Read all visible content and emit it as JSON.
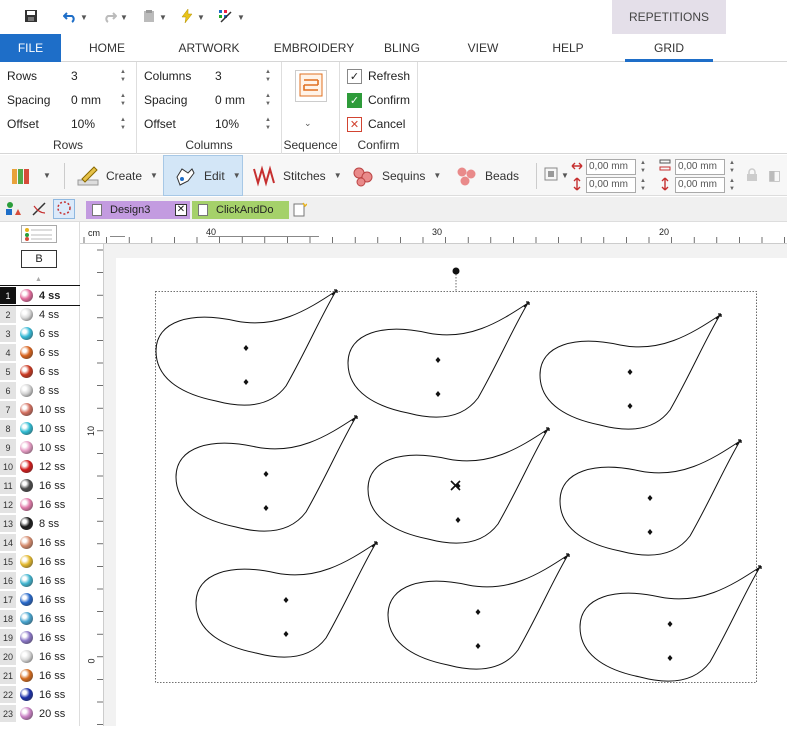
{
  "quick_access": {
    "icons": [
      "save-icon",
      "undo-icon",
      "redo-icon",
      "clipboard-icon",
      "lightning-icon",
      "grid-magic-icon"
    ]
  },
  "context_tab": "REPETITIONS",
  "tabs": [
    "FILE",
    "HOME",
    "ARTWORK",
    "EMBROIDERY",
    "BLING",
    "VIEW",
    "HELP",
    "GRID"
  ],
  "active_tab": "GRID",
  "ribbon": {
    "rows": {
      "label": "Rows",
      "fields": [
        {
          "name": "Rows",
          "value": "3"
        },
        {
          "name": "Spacing",
          "value": "0 mm"
        },
        {
          "name": "Offset",
          "value": "10%"
        }
      ]
    },
    "columns": {
      "label": "Columns",
      "fields": [
        {
          "name": "Columns",
          "value": "3"
        },
        {
          "name": "Spacing",
          "value": "0 mm"
        },
        {
          "name": "Offset",
          "value": "10%"
        }
      ]
    },
    "sequence": {
      "label": "Sequence"
    },
    "confirm": {
      "label": "Confirm",
      "refresh": "Refresh",
      "confirm": "Confirm",
      "cancel": "Cancel"
    }
  },
  "toolbar": {
    "create": "Create",
    "edit": "Edit",
    "stitches": "Stitches",
    "sequins": "Sequins",
    "beads": "Beads",
    "fields": [
      "0,00 mm",
      "0,00 mm",
      "0,00 mm",
      "0,00 mm"
    ]
  },
  "doc_tabs": [
    {
      "name": "Design3",
      "color": "#c39be0"
    },
    {
      "name": "ClickAndDo",
      "color": "#a5d16a"
    }
  ],
  "palette_header": "B",
  "palette": [
    {
      "n": "1",
      "size": "4 ss",
      "color": "#e26b9c"
    },
    {
      "n": "2",
      "size": "4 ss",
      "color": "#d9d9d9"
    },
    {
      "n": "3",
      "size": "6 ss",
      "color": "#35b9d6"
    },
    {
      "n": "4",
      "size": "6 ss",
      "color": "#d8621c"
    },
    {
      "n": "5",
      "size": "6 ss",
      "color": "#c9361f"
    },
    {
      "n": "6",
      "size": "8 ss",
      "color": "#d3d3d3"
    },
    {
      "n": "7",
      "size": "10 ss",
      "color": "#d36f5f"
    },
    {
      "n": "8",
      "size": "10 ss",
      "color": "#2fbcd3"
    },
    {
      "n": "9",
      "size": "10 ss",
      "color": "#e69cc4"
    },
    {
      "n": "10",
      "size": "12 ss",
      "color": "#d11a1a"
    },
    {
      "n": "11",
      "size": "16 ss",
      "color": "#4a4a4a"
    },
    {
      "n": "12",
      "size": "16 ss",
      "color": "#e07aa9"
    },
    {
      "n": "13",
      "size": "8 ss",
      "color": "#1a1a1a"
    },
    {
      "n": "14",
      "size": "16 ss",
      "color": "#d4896b"
    },
    {
      "n": "15",
      "size": "16 ss",
      "color": "#e2b72b"
    },
    {
      "n": "16",
      "size": "16 ss",
      "color": "#3fb4cf"
    },
    {
      "n": "17",
      "size": "16 ss",
      "color": "#2567c9"
    },
    {
      "n": "18",
      "size": "16 ss",
      "color": "#46a4cf"
    },
    {
      "n": "19",
      "size": "16 ss",
      "color": "#8a76c6"
    },
    {
      "n": "20",
      "size": "16 ss",
      "color": "#d8d8d8"
    },
    {
      "n": "21",
      "size": "16 ss",
      "color": "#d46a1c"
    },
    {
      "n": "22",
      "size": "16 ss",
      "color": "#1a2fa8"
    },
    {
      "n": "23",
      "size": "20 ss",
      "color": "#c981c4"
    }
  ],
  "ruler": {
    "unit": "cm",
    "top_ticks": [
      "40",
      "30",
      "20"
    ],
    "left_ticks": [
      "10",
      "0"
    ]
  },
  "colors": {
    "accent": "#1e6ec8",
    "context": "#e4dfe9"
  }
}
